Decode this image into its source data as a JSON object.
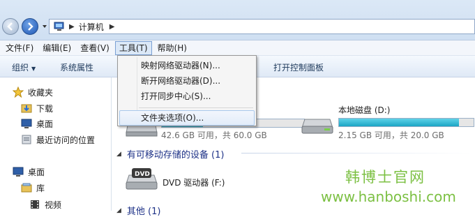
{
  "address": {
    "path": "计算机"
  },
  "menubar": {
    "items": [
      {
        "label": "文件(F)"
      },
      {
        "label": "编辑(E)"
      },
      {
        "label": "查看(V)"
      },
      {
        "label": "工具(T)"
      },
      {
        "label": "帮助(H)"
      }
    ],
    "active_index": 3
  },
  "toolbar": {
    "organize": "组织",
    "system_properties": "系统属性",
    "open_control_panel": "打开控制面板"
  },
  "sidebar": {
    "favorites": "收藏夹",
    "downloads": "下载",
    "desktop_fav": "桌面",
    "recent_places": "最近访问的位置",
    "desktop": "桌面",
    "libraries": "库",
    "videos": "视频"
  },
  "content": {
    "drive_c": {
      "size_text": "42.6 GB 可用，共 60.0 GB",
      "used_fraction": 0.29
    },
    "drive_d": {
      "name": "本地磁盘 (D:)",
      "size_text": "2.15 GB 可用，共 20.0 GB",
      "used_fraction": 0.89
    },
    "removable_group": "有可移动存储的设备 (1)",
    "dvd_name": "DVD 驱动器 (F:)",
    "other_group": "其他 (1)"
  },
  "tools_menu": {
    "items": [
      {
        "label": "映射网络驱动器(N)..."
      },
      {
        "label": "断开网络驱动器(D)..."
      },
      {
        "label": "打开同步中心(S)..."
      },
      {
        "label": "文件夹选项(O)..."
      }
    ]
  },
  "watermark": {
    "line1": "韩博士官网",
    "line2": "www.hanboshi.com"
  },
  "colors": {
    "accent": "#1ba5c4",
    "watermark": "#7cc043",
    "group_header": "#1e3287"
  }
}
